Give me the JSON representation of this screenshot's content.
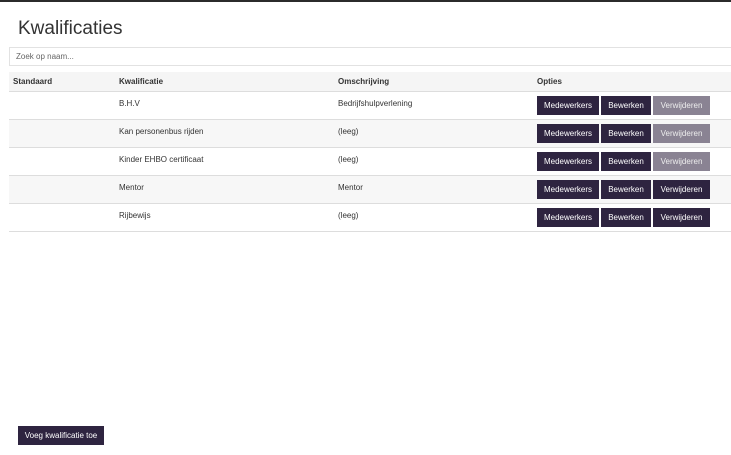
{
  "page": {
    "title": "Kwalificaties"
  },
  "search": {
    "placeholder": "Zoek op naam..."
  },
  "table": {
    "headers": {
      "standaard": "Standaard",
      "kwalificatie": "Kwalificatie",
      "omschrijving": "Omschrijving",
      "opties": "Opties"
    },
    "rows": [
      {
        "standaard": "",
        "kwalificatie": "B.H.V",
        "omschrijving": "Bedrijfshulpverlening",
        "delete_disabled": true
      },
      {
        "standaard": "",
        "kwalificatie": "Kan personenbus rijden",
        "omschrijving": "(leeg)",
        "delete_disabled": true
      },
      {
        "standaard": "",
        "kwalificatie": "Kinder EHBO certificaat",
        "omschrijving": "(leeg)",
        "delete_disabled": true
      },
      {
        "standaard": "",
        "kwalificatie": "Mentor",
        "omschrijving": "Mentor",
        "delete_disabled": false
      },
      {
        "standaard": "",
        "kwalificatie": "Rijbewijs",
        "omschrijving": "(leeg)",
        "delete_disabled": false
      }
    ],
    "buttons": {
      "employees": "Medewerkers",
      "edit": "Bewerken",
      "delete": "Verwijderen"
    }
  },
  "footer": {
    "add_label": "Voeg kwalificatie toe"
  },
  "colors": {
    "primary_button": "#2e2440",
    "disabled_button": "#8a8393",
    "row_stripe": "#f7f7f7"
  }
}
